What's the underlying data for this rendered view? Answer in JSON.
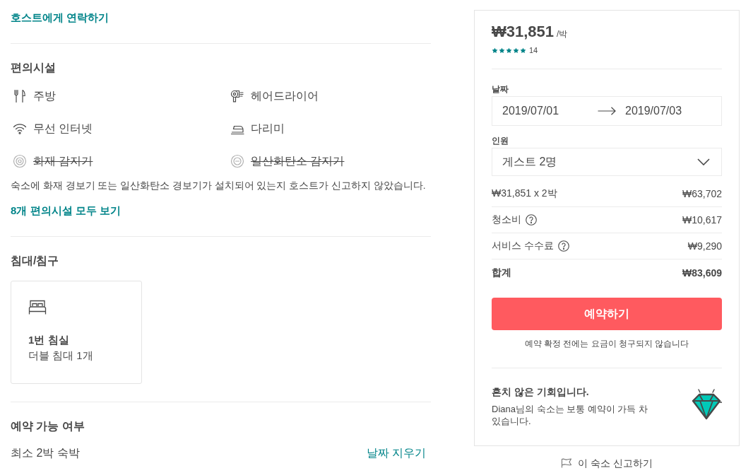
{
  "host_contact": {
    "link": "호스트에게 연락하기"
  },
  "amenities": {
    "title": "편의시설",
    "items": [
      {
        "label": "주방",
        "available": true
      },
      {
        "label": "헤어드라이어",
        "available": true
      },
      {
        "label": "무선 인터넷",
        "available": true
      },
      {
        "label": "다리미",
        "available": true
      },
      {
        "label": "화재 감지기",
        "available": false
      },
      {
        "label": "일산화탄소 감지기",
        "available": false
      }
    ],
    "note": "숙소에 화재 경보기 또는 일산화탄소 경보기가 설치되어 있는지 호스트가 신고하지 않았습니다.",
    "show_all": "8개 편의시설 모두 보기"
  },
  "sleeping": {
    "title": "침대/침구",
    "rooms": [
      {
        "name": "1번 침실",
        "beds": "더블 침대 1개"
      }
    ]
  },
  "availability": {
    "title": "예약 가능 여부",
    "min_stay": "최소 2박 숙박",
    "clear_dates": "날짜 지우기"
  },
  "booking": {
    "price": "₩31,851",
    "per": "/박",
    "rating": {
      "stars": 5,
      "count": "14"
    },
    "dates": {
      "label": "날짜",
      "check_in": "2019/07/01",
      "check_out": "2019/07/03"
    },
    "guests": {
      "label": "인원",
      "value": "게스트 2명"
    },
    "lines": [
      {
        "kind": "line",
        "label": "₩31,851 x 2박",
        "amount": "₩63,702",
        "help": false
      },
      {
        "kind": "line",
        "label": "청소비",
        "amount": "₩10,617",
        "help": true
      },
      {
        "kind": "line",
        "label": "서비스 수수료",
        "amount": "₩9,290",
        "help": true
      },
      {
        "kind": "total",
        "label": "합계",
        "amount": "₩83,609",
        "help": false
      }
    ],
    "button": "예약하기",
    "note": "예약 확정 전에는 요금이 청구되지 않습니다",
    "rare_find": {
      "title": "흔치 않은 기회입니다.",
      "text": "Diana님의 숙소는 보통 예약이 가득 차 있습니다."
    }
  },
  "report": {
    "link": "이 숙소 신고하기"
  }
}
